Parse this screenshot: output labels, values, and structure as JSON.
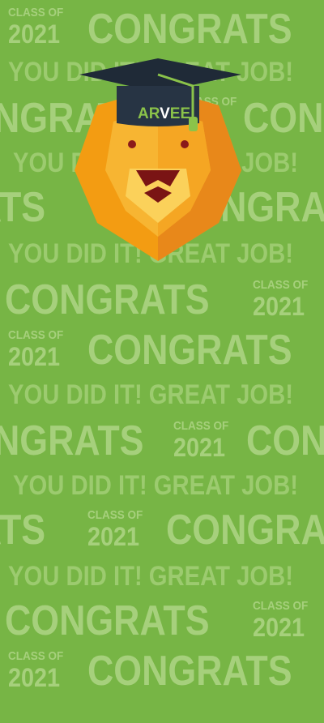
{
  "pattern": {
    "congrats": "CONGRATS",
    "congrats_partial": "NGRATS",
    "congrats_tail": "ATS",
    "congrats_head": "CONGRA",
    "congrats_head2": "CON",
    "you_did_it": "YOU DID IT! GREAT JOB!",
    "class_of": "CLASS OF",
    "year": "2021"
  },
  "mascot": {
    "cap_label_part1": "AR",
    "cap_label_part2": "V",
    "cap_label_part3": "EE"
  },
  "colors": {
    "background": "#77b545",
    "pattern_text": "#a6d07c",
    "cap": "#1f2a37",
    "tassel": "#8bc34a",
    "mane": "#f39c12",
    "face": "#f7c948"
  }
}
